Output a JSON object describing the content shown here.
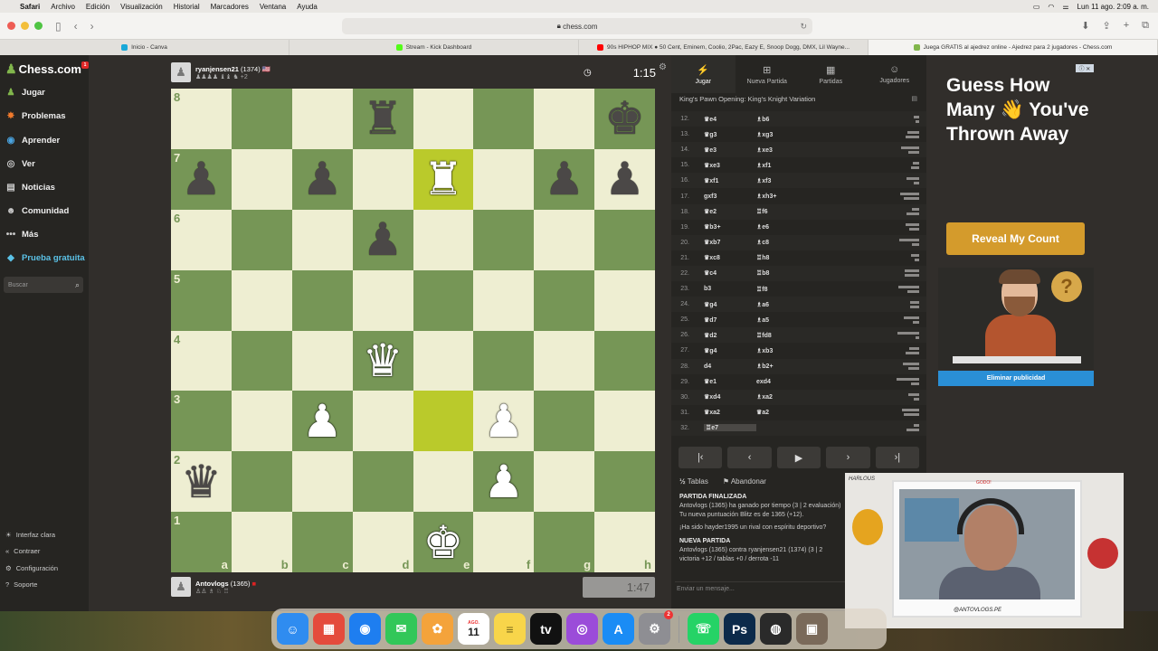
{
  "menubar": {
    "app": "Safari",
    "items": [
      "Archivo",
      "Edición",
      "Visualización",
      "Historial",
      "Marcadores",
      "Ventana",
      "Ayuda"
    ],
    "datetime": "Lun 11 ago.  2:09 a. m."
  },
  "browser": {
    "url": "chess.com",
    "tabs": [
      {
        "label": "Inicio - Canva",
        "color": "#18a8d8"
      },
      {
        "label": "Stream - Kick Dashboard",
        "color": "#53fc18"
      },
      {
        "label": "90s HIPHOP MIX ● 50 Cent, Eminem, Coolio, 2Pac, Eazy E, Snoop Dogg, DMX, Lil Wayne...",
        "color": "#ff0000"
      },
      {
        "label": "Juega GRATIS al ajedrez online - Ajedrez para 2 jugadores - Chess.com",
        "color": "#81b64c"
      }
    ]
  },
  "sidebar": {
    "logo": "Chess.com",
    "badge": "1",
    "items": [
      {
        "label": "Jugar",
        "icon": "♟",
        "color": "#81b64c"
      },
      {
        "label": "Problemas",
        "icon": "✸",
        "color": "#f07a2c"
      },
      {
        "label": "Aprender",
        "icon": "◉",
        "color": "#4aa3df"
      },
      {
        "label": "Ver",
        "icon": "◎",
        "color": "#cccccc"
      },
      {
        "label": "Noticias",
        "icon": "▤",
        "color": "#cccccc"
      },
      {
        "label": "Comunidad",
        "icon": "☻",
        "color": "#cccccc"
      },
      {
        "label": "Más",
        "icon": "•••",
        "color": "#cccccc"
      },
      {
        "label": "Prueba gratuita",
        "icon": "◆",
        "color": "#5bc2e7"
      }
    ],
    "search_placeholder": "Buscar",
    "bottom": [
      {
        "label": "Interfaz clara",
        "icon": "☀"
      },
      {
        "label": "Contraer",
        "icon": "«"
      },
      {
        "label": "Configuración",
        "icon": "⚙"
      },
      {
        "label": "Soporte",
        "icon": "?"
      }
    ]
  },
  "game": {
    "top_player": {
      "name": "ryanjensen21",
      "rating": "(1374)",
      "material": "+2",
      "clock": "1:15"
    },
    "bottom_player": {
      "name": "Antovlogs",
      "rating": "(1365)",
      "clock": "1:47"
    },
    "ranks": [
      "8",
      "7",
      "6",
      "5",
      "4",
      "3",
      "2",
      "1"
    ],
    "files": [
      "a",
      "b",
      "c",
      "d",
      "e",
      "f",
      "g",
      "h"
    ],
    "board": [
      [
        "",
        "",
        "",
        "bR",
        "",
        "",
        "",
        "bK"
      ],
      [
        "bP",
        "",
        "bP",
        "",
        "wR",
        "",
        "bP",
        "bP"
      ],
      [
        "",
        "",
        "",
        "bP",
        "",
        "",
        "",
        ""
      ],
      [
        "",
        "",
        "",
        "",
        "",
        "",
        "",
        ""
      ],
      [
        "",
        "",
        "",
        "wQ",
        "",
        "",
        "",
        ""
      ],
      [
        "",
        "",
        "wP",
        "",
        "",
        "wP",
        "",
        ""
      ],
      [
        "bQ",
        "",
        "",
        "",
        "",
        "wP",
        "",
        ""
      ],
      [
        "",
        "",
        "",
        "",
        "wK",
        "",
        "",
        ""
      ]
    ],
    "highlights": [
      "e7",
      "e3"
    ]
  },
  "panel": {
    "tabs": [
      {
        "label": "Jugar",
        "icon": "⚡"
      },
      {
        "label": "Nueva Partida",
        "icon": "⊞"
      },
      {
        "label": "Partidas",
        "icon": "▦"
      },
      {
        "label": "Jugadores",
        "icon": "☺"
      }
    ],
    "opening": "King's Pawn Opening: King's Knight Variation",
    "moves": [
      {
        "n": "12.",
        "w": "♛e4",
        "b": "♗b6"
      },
      {
        "n": "13.",
        "w": "♛g3",
        "b": "♗xg3"
      },
      {
        "n": "14.",
        "w": "♛e3",
        "b": "♗xe3"
      },
      {
        "n": "15.",
        "w": "♛xe3",
        "b": "♗xf1"
      },
      {
        "n": "16.",
        "w": "♛xf1",
        "b": "♗xf3"
      },
      {
        "n": "17.",
        "w": "gxf3",
        "b": "♗xh3+"
      },
      {
        "n": "18.",
        "w": "♛e2",
        "b": "♖f6"
      },
      {
        "n": "19.",
        "w": "♛b3+",
        "b": "♗e6"
      },
      {
        "n": "20.",
        "w": "♛xb7",
        "b": "♗c8"
      },
      {
        "n": "21.",
        "w": "♛xc8",
        "b": "♖h8"
      },
      {
        "n": "22.",
        "w": "♛c4",
        "b": "♖b8"
      },
      {
        "n": "23.",
        "w": "b3",
        "b": "♖f8"
      },
      {
        "n": "24.",
        "w": "♛g4",
        "b": "♗a6"
      },
      {
        "n": "25.",
        "w": "♛d7",
        "b": "♗a5"
      },
      {
        "n": "26.",
        "w": "♛d2",
        "b": "♖fd8"
      },
      {
        "n": "27.",
        "w": "♛g4",
        "b": "♗xb3"
      },
      {
        "n": "28.",
        "w": "d4",
        "b": "♗b2+"
      },
      {
        "n": "29.",
        "w": "♛e1",
        "b": "exd4"
      },
      {
        "n": "30.",
        "w": "♛xd4",
        "b": "♗xa2"
      },
      {
        "n": "31.",
        "w": "♛xa2",
        "b": "♛a2"
      },
      {
        "n": "32.",
        "w": "♖e7",
        "b": ""
      }
    ],
    "controls": [
      "|‹",
      "‹",
      "▶",
      "›",
      "›|"
    ],
    "actions": {
      "draw": "Tablas",
      "resign": "Abandonar",
      "draw_icon": "½"
    },
    "chat": {
      "l1": "PARTIDA FINALIZADA",
      "l2": "Antovlogs (1365) ha ganado por tiempo (3 | 2 evaluación)",
      "l3": "Tu nueva puntuación Blitz es de 1365 (+12).",
      "l4": "¡Ha sido hayder1995 un rival con espíritu deportivo?",
      "l5": "NUEVA PARTIDA",
      "l6": "Antovlogs (1365) contra ryanjensen21 (1374) (3 | 2",
      "l7": "victoria +12 / tablas +0 / derrota -11",
      "input_placeholder": "Enviar un mensaje..."
    }
  },
  "ad": {
    "close": "ⓘ ✕",
    "title": "Guess How Many 👋 You've Thrown Away",
    "button": "Reveal My Count",
    "remove": "Eliminar publicidad",
    "qmark": "?"
  },
  "webcam": {
    "signature": "@ANTOVLOGS.PE",
    "top_tag": "GODO!",
    "logo": "HARLOUS"
  },
  "dock": {
    "icons": [
      {
        "name": "finder",
        "color": "#2f8cf0",
        "glyph": "☺"
      },
      {
        "name": "launchpad",
        "color": "#e44b3c",
        "glyph": "▦"
      },
      {
        "name": "safari",
        "color": "#1e7ef0",
        "glyph": "◉"
      },
      {
        "name": "messages",
        "color": "#32c759",
        "glyph": "✉"
      },
      {
        "name": "photos",
        "color": "#f4a33b",
        "glyph": "✿"
      },
      {
        "name": "calendar",
        "color": "#ffffff",
        "glyph": "11"
      },
      {
        "name": "notes",
        "color": "#f8d54a",
        "glyph": "≡"
      },
      {
        "name": "tv",
        "color": "#111111",
        "glyph": "tv"
      },
      {
        "name": "podcasts",
        "color": "#9b4cd9",
        "glyph": "◎"
      },
      {
        "name": "appstore",
        "color": "#1a8cf5",
        "glyph": "A"
      },
      {
        "name": "settings",
        "color": "#8e8e93",
        "glyph": "⚙"
      },
      {
        "name": "whatsapp",
        "color": "#25d366",
        "glyph": "☏"
      },
      {
        "name": "photoshop",
        "color": "#0c2a4a",
        "glyph": "Ps"
      },
      {
        "name": "obs",
        "color": "#2a2a2a",
        "glyph": "◍"
      },
      {
        "name": "preview",
        "color": "#7a6a5a",
        "glyph": "▣"
      }
    ],
    "settings_badge": "2",
    "calendar_month": "AGO."
  }
}
